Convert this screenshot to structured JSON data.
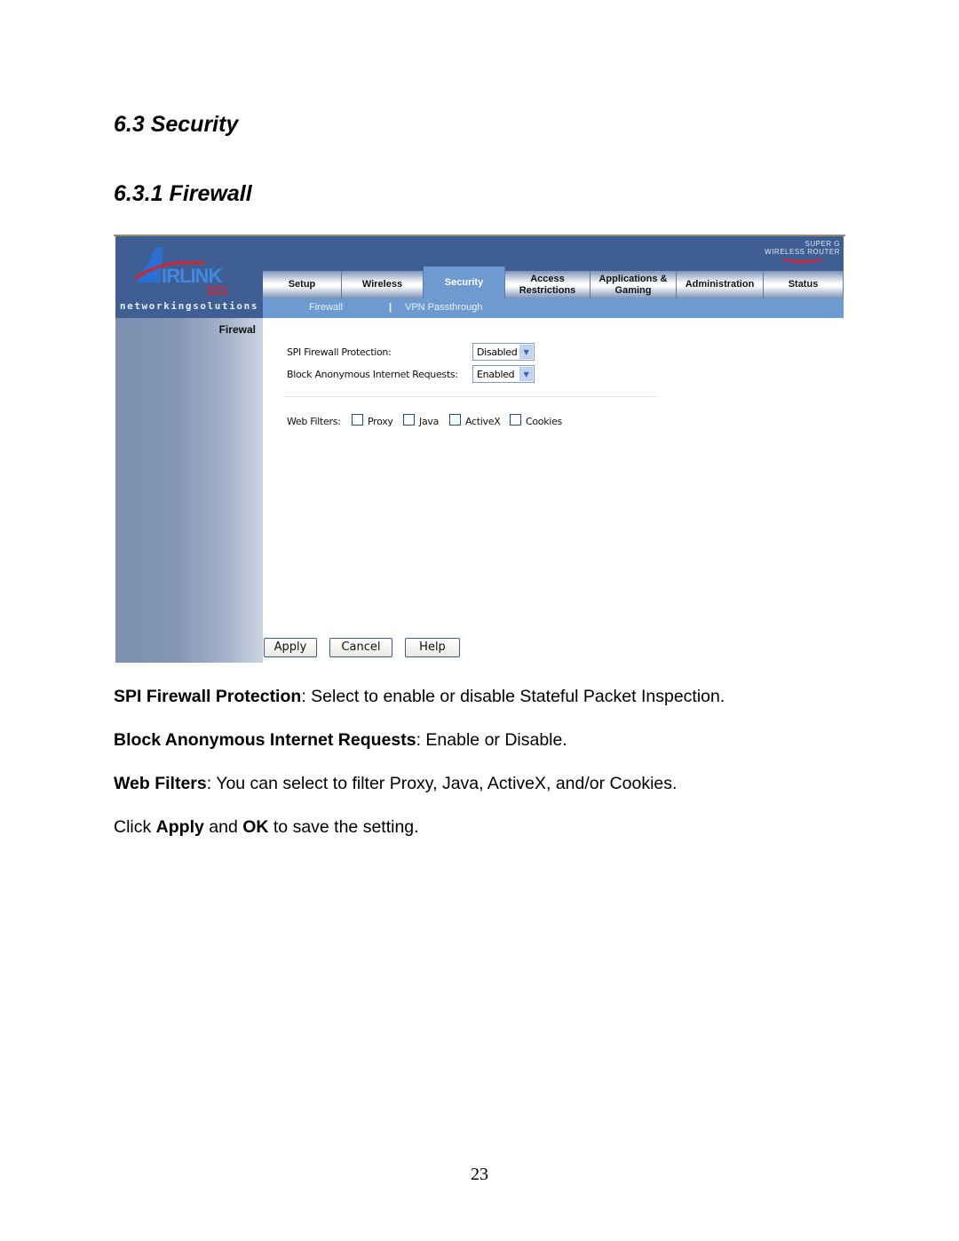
{
  "headings": {
    "section": "6.3 Security",
    "subsection": "6.3.1 Firewall"
  },
  "router_ui": {
    "logo": {
      "brand": "AIRLINK",
      "number": "101",
      "tagline": "networkingsolutions",
      "product_line1": "SUPER G",
      "product_line2": "WIRELESS ROUTER",
      "accent_red": "#d2232f",
      "accent_blue": "#3f5f94"
    },
    "tabs": [
      {
        "label": "Setup",
        "active": false
      },
      {
        "label": "Wireless",
        "active": false
      },
      {
        "label": "Security",
        "active": true
      },
      {
        "label": "Access Restrictions",
        "active": false
      },
      {
        "label": "Applications & Gaming",
        "active": false
      },
      {
        "label": "Administration",
        "active": false
      },
      {
        "label": "Status",
        "active": false
      }
    ],
    "subtabs": [
      {
        "label": "Firewall"
      },
      {
        "label": "VPN Passthrough"
      }
    ],
    "subtab_separator": "|",
    "sidebar_title": "Firewal",
    "form": {
      "spi_label": "SPI Firewall Protection:",
      "spi_value": "Disabled",
      "block_label": "Block Anonymous Internet Requests:",
      "block_value": "Enabled",
      "web_filters_label": "Web Filters:",
      "filters": [
        {
          "label": "Proxy",
          "checked": false
        },
        {
          "label": "Java",
          "checked": false
        },
        {
          "label": "ActiveX",
          "checked": false
        },
        {
          "label": "Cookies",
          "checked": false
        }
      ]
    },
    "buttons": {
      "apply": "Apply",
      "cancel": "Cancel",
      "help": "Help"
    }
  },
  "description": {
    "p1_bold": "SPI Firewall Protection",
    "p1_text": ": Select to enable or disable Stateful Packet Inspection.",
    "p2_bold": "Block Anonymous Internet Requests",
    "p2_text": ": Enable or Disable.",
    "p3_bold": "Web Filters",
    "p3_text": ": You can select to filter Proxy, Java, ActiveX, and/or Cookies.",
    "p4_pre": "Click ",
    "p4_bold1": "Apply",
    "p4_mid": " and ",
    "p4_bold2": "OK",
    "p4_post": " to save the setting."
  },
  "page_number": "23"
}
